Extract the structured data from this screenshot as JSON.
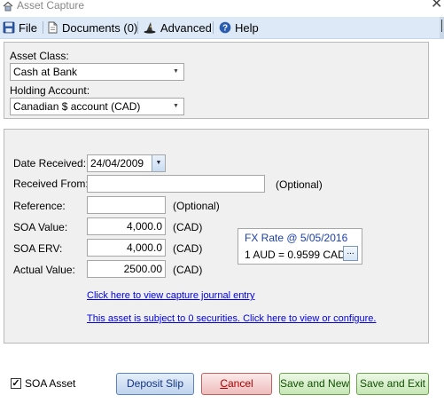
{
  "window": {
    "title": "Asset Capture",
    "close_symbol": "✕"
  },
  "menu": {
    "file": "File",
    "documents": "Documents (0)",
    "advanced": "Advanced",
    "help": "Help"
  },
  "asset_class": {
    "label": "Asset Class:",
    "value": "Cash at Bank"
  },
  "holding_account": {
    "label": "Holding Account:",
    "value": "Canadian $ account (CAD)"
  },
  "form": {
    "date_received": {
      "label": "Date Received:",
      "value": "24/04/2009"
    },
    "received_from": {
      "label": "Received From:",
      "value": "",
      "hint": "(Optional)"
    },
    "reference": {
      "label": "Reference:",
      "value": "",
      "hint": "(Optional)"
    },
    "soa_value": {
      "label": "SOA Value:",
      "value": "4,000.0",
      "unit": "(CAD)"
    },
    "soa_erv": {
      "label": "SOA ERV:",
      "value": "4,000.0",
      "unit": "(CAD)"
    },
    "actual_value": {
      "label": "Actual Value:",
      "value": "2500.00",
      "unit": "(CAD)"
    }
  },
  "fx": {
    "title": "FX Rate @ 5/05/2016",
    "rate": "1 AUD = 0.9599 CAD",
    "button": "..."
  },
  "links": {
    "journal": "Click here to view capture journal entry",
    "securities": "This asset is subject to 0 securities.  Click here to view or configure."
  },
  "soa_asset": {
    "label": "SOA Asset",
    "checked": true,
    "check_mark": "✓"
  },
  "buttons": {
    "deposit_slip": "Deposit Slip",
    "cancel_first": "C",
    "cancel_rest": "ancel",
    "save_new": "Save and New",
    "save_exit": "Save and Exit"
  }
}
